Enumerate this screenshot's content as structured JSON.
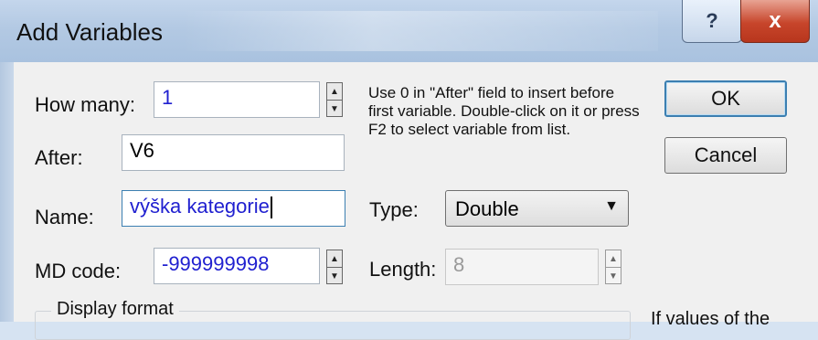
{
  "window": {
    "title": "Add Variables",
    "help_glyph": "?",
    "close_glyph": "x"
  },
  "form": {
    "how_many": {
      "label": "How many:",
      "value": "1"
    },
    "after": {
      "label": "After:",
      "value": "V6"
    },
    "name": {
      "label": "Name:",
      "value": "výška kategorie"
    },
    "md_code": {
      "label": "MD code:",
      "value": "-999999998"
    },
    "type": {
      "label": "Type:",
      "selected": "Double"
    },
    "length": {
      "label": "Length:",
      "value": "8"
    }
  },
  "info_text": "Use 0 in \"After\" field to insert before first variable. Double-click on it or press F2 to select variable from list.",
  "buttons": {
    "ok": "OK",
    "cancel": "Cancel"
  },
  "display_format": {
    "title": "Display format"
  },
  "side_note": "If values of the",
  "icons": {
    "help": "help-icon",
    "close": "close-icon",
    "spin_up": "spin-up-icon",
    "spin_down": "spin-down-icon",
    "dropdown": "chevron-down-icon"
  }
}
